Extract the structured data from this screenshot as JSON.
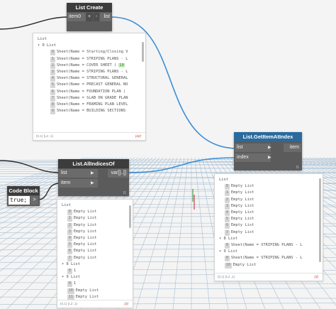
{
  "nodes": {
    "list_create": {
      "title": "List Create",
      "input": "item0",
      "plus": "+",
      "minus": "-",
      "output": "list"
    },
    "get_item": {
      "title": "List.GetItemAtIndex",
      "in1": "list",
      "in2": "index",
      "output": "item",
      "lacing": "l1"
    },
    "all_indices": {
      "title": "List.AllIndicesOf",
      "in1": "list",
      "in2": "item",
      "output": "var[]..[]",
      "lacing": "l1"
    },
    "code_block": {
      "title": "Code Block",
      "code": "true;",
      "output": ">"
    }
  },
  "preview1": {
    "rows": [
      {
        "indent": "List",
        "idx": "",
        "text": ""
      },
      {
        "indent": "  ▾ 0 List",
        "idx": "",
        "text": ""
      },
      {
        "idx": "0",
        "text": "Sheet(Name = Starting/Closing V"
      },
      {
        "idx": "1",
        "text": "Sheet(Name = STRIPING PLANS - L"
      },
      {
        "idx": "2",
        "text": "Sheet(Name = COVER SHEET )",
        "badge": "19"
      },
      {
        "idx": "3",
        "text": "Sheet(Name = STRIPING PLANS - L"
      },
      {
        "idx": "4",
        "text": "Sheet(Name = STRUCTURAL GENERAL"
      },
      {
        "idx": "5",
        "text": "Sheet(Name = PRECAST GENERAL NO"
      },
      {
        "idx": "6",
        "text": "Sheet(Name = FOUNDATION PLAN )"
      },
      {
        "idx": "7",
        "text": "Sheet(Name = SLAB ON GRADE PLAN"
      },
      {
        "idx": "8",
        "text": "Sheet(Name = FRAMING PLAN LEVEL"
      },
      {
        "idx": "9",
        "text": "Sheet(Name = BUILDING SECTIONS"
      }
    ],
    "foot": "{0,1} {L2 ,1}",
    "count": "{42}"
  },
  "preview2": {
    "rows": [
      {
        "text": "List"
      },
      {
        "idx": "0",
        "text": "Empty List"
      },
      {
        "idx": "1",
        "text": "Empty List"
      },
      {
        "idx": "2",
        "text": "Empty List"
      },
      {
        "idx": "3",
        "text": "Empty List"
      },
      {
        "idx": "4",
        "text": "Empty List"
      },
      {
        "idx": "5",
        "text": "Empty List"
      },
      {
        "idx": "6",
        "text": "Empty List"
      },
      {
        "idx": "7",
        "text": "Empty List"
      },
      {
        "text": "  ▾ 8 List"
      },
      {
        "idx": "0",
        "text": "Sheet(Name = STRIPING PLANS - L"
      },
      {
        "text": "  ▾ 9 List"
      },
      {
        "idx": "0",
        "text": "Sheet(Name = STRIPING PLANS - L"
      },
      {
        "idx": "10",
        "text": "Empty List"
      }
    ],
    "foot": "{0,1} {L2 ,1}",
    "count": "{3}"
  },
  "preview3": {
    "rows": [
      {
        "text": "List"
      },
      {
        "idx": "0",
        "text": "Empty List"
      },
      {
        "idx": "1",
        "text": "Empty List"
      },
      {
        "idx": "2",
        "text": "Empty List"
      },
      {
        "idx": "3",
        "text": "Empty List"
      },
      {
        "idx": "4",
        "text": "Empty List"
      },
      {
        "idx": "5",
        "text": "Empty List"
      },
      {
        "idx": "6",
        "text": "Empty List"
      },
      {
        "idx": "7",
        "text": "Empty List"
      },
      {
        "text": "  ▾ 8 List"
      },
      {
        "idx": "0",
        "text": "1"
      },
      {
        "text": "  ▾ 9 List"
      },
      {
        "idx": "0",
        "text": "1"
      },
      {
        "idx": "10",
        "text": "Empty List"
      },
      {
        "idx": "11",
        "text": "Empty List"
      }
    ],
    "foot": "{0,1} {L2 ,1}",
    "count": "{3}"
  },
  "colors": {
    "wire_blue": "#3b8ed6",
    "wire_dark": "#2b2b2b",
    "node_header": "#3c3c3c",
    "grid": "#a9c3d6"
  }
}
